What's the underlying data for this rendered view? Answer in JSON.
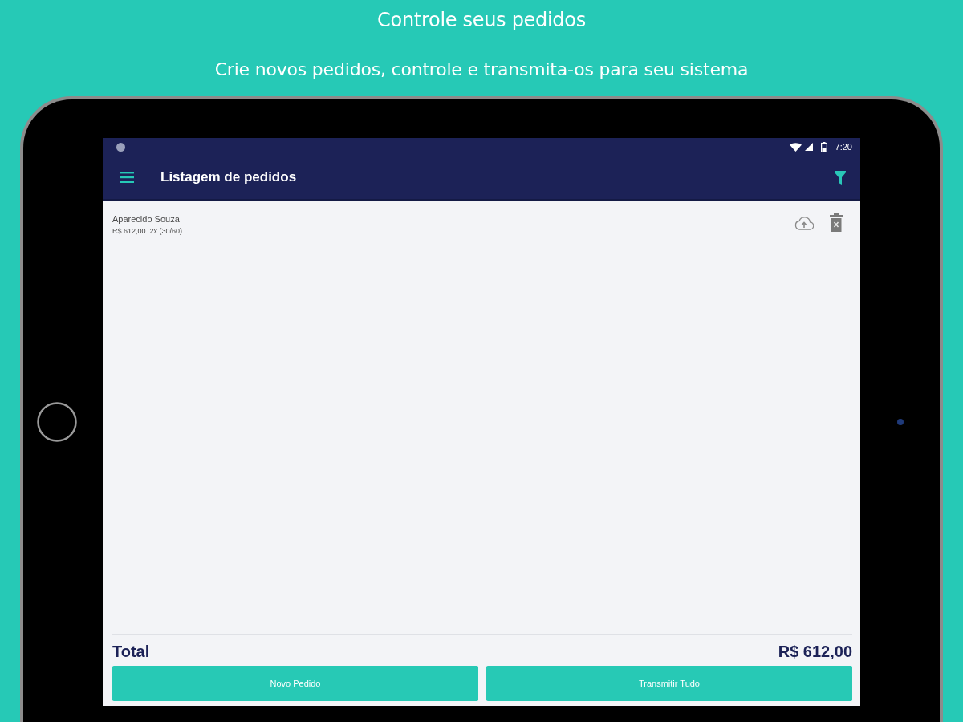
{
  "header": {
    "title": "Controle seus pedidos",
    "subtitle": "Crie novos pedidos, controle e transmita-os para seu sistema"
  },
  "status_bar": {
    "time": "7:20"
  },
  "app_bar": {
    "title": "Listagem de pedidos"
  },
  "orders": [
    {
      "customer": "Aparecido Souza",
      "amount": "R$ 612,00",
      "installments": "2x (30/60)"
    }
  ],
  "footer": {
    "total_label": "Total",
    "total_value": "R$ 612,00"
  },
  "buttons": [
    "Novo Pedido",
    "Transmitir Tudo"
  ]
}
